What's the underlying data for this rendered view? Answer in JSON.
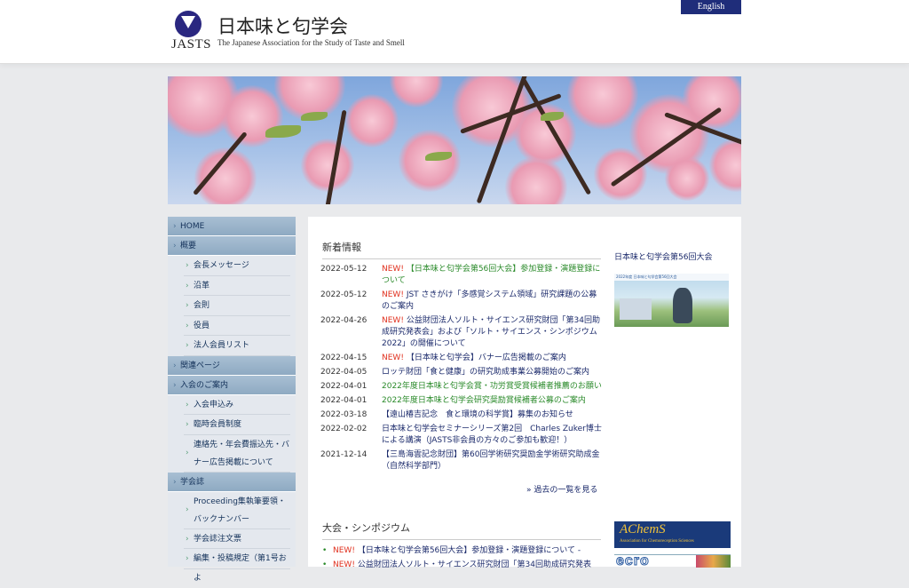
{
  "header": {
    "logo_abbr": "JASTS",
    "title": "日本味と匂学会",
    "subtitle": "The Japanese Association for the Study of Taste and Smell",
    "lang_button": "English"
  },
  "sidebar": {
    "items": [
      {
        "label": "HOME",
        "level": 1
      },
      {
        "label": "概要",
        "level": 1
      },
      {
        "label": "会長メッセージ",
        "level": 2
      },
      {
        "label": "沿革",
        "level": 2
      },
      {
        "label": "会則",
        "level": 2
      },
      {
        "label": "役員",
        "level": 2
      },
      {
        "label": "法人会員リスト",
        "level": 2
      },
      {
        "label": "関連ページ",
        "level": 1
      },
      {
        "label": "入会のご案内",
        "level": 1
      },
      {
        "label": "入会申込み",
        "level": 2
      },
      {
        "label": "臨時会員制度",
        "level": 2
      },
      {
        "label": "連絡先・年会費振込先・バナー広告掲載について",
        "level": 2
      },
      {
        "label": "学会誌",
        "level": 1
      },
      {
        "label": "Proceeding集執筆要領・バックナンバー",
        "level": 2
      },
      {
        "label": "学会誌注文票",
        "level": 2
      },
      {
        "label": "編集・投稿規定（第1号およ",
        "level": 2
      }
    ]
  },
  "news": {
    "title": "新着情報",
    "new_label": "NEW!",
    "items": [
      {
        "date": "2022-05-12",
        "is_new": true,
        "text": "【日本味と匂学会第56回大会】参加登録・演題登録について",
        "color": "#2a8a2a"
      },
      {
        "date": "2022-05-12",
        "is_new": true,
        "text": "JST さきがけ「多感覚システム領域」研究課題の公募のご案内",
        "color": "#1b2a6b"
      },
      {
        "date": "2022-04-26",
        "is_new": true,
        "text": "公益財団法人ソルト・サイエンス研究財団「第34回助成研究発表会」および「ソルト・サイエンス・シンポジウム2022」の開催について",
        "color": "#1b2a6b"
      },
      {
        "date": "2022-04-15",
        "is_new": true,
        "text": "【日本味と匂学会】バナー広告掲載のご案内",
        "color": "#1b2a6b"
      },
      {
        "date": "2022-04-05",
        "is_new": false,
        "text": "ロッテ財団「食と健康」の研究助成事業公募開始のご案内",
        "color": "#1b2a6b"
      },
      {
        "date": "2022-04-01",
        "is_new": false,
        "text": "2022年度日本味と匂学会賞・功労賞受賞候補者推薦のお願い",
        "color": "#2a8a2a"
      },
      {
        "date": "2022-04-01",
        "is_new": false,
        "text": "2022年度日本味と匂学会研究奨励賞候補者公募のご案内",
        "color": "#2a8a2a"
      },
      {
        "date": "2022-03-18",
        "is_new": false,
        "text": "【遠山椿吉記念　食と環境の科学賞】募集のお知らせ",
        "color": "#1b2a6b"
      },
      {
        "date": "2022-02-02",
        "is_new": false,
        "text": "日本味と匂学会セミナーシリーズ第2回　Charles Zuker博士による講演（JASTS非会員の方々のご参加も歓迎！）",
        "color": "#1b2a6b"
      },
      {
        "date": "2021-12-14",
        "is_new": false,
        "text": "【三島海雲記念財団】第60回学術研究奨励金学術研究助成金（自然科学部門）",
        "color": "#1b2a6b"
      }
    ],
    "more_link": "» 過去の一覧を見る"
  },
  "symposium": {
    "title": "大会・シンポジウム",
    "items": [
      {
        "is_new": true,
        "text": "【日本味と匂学会第56回大会】参加登録・演題登録について -"
      },
      {
        "is_new": true,
        "text": "公益財団法人ソルト・サイエンス研究財団「第34回助成研究発表"
      }
    ]
  },
  "right": {
    "convention_link": "日本味と匂学会第56回大会",
    "thumb_caption": "2022年度 日本味と匂学会第56回大会",
    "banner_achems_title": "AChemS",
    "banner_achems_sub": "Association for Chemoreception Sciences",
    "banner_ecro": "ecro"
  }
}
